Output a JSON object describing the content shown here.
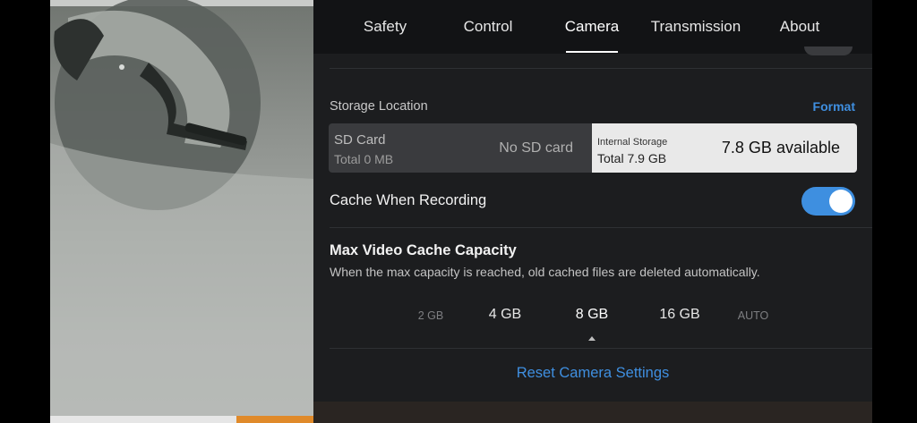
{
  "tabs": [
    {
      "label": "Safety"
    },
    {
      "label": "Control"
    },
    {
      "label": "Camera"
    },
    {
      "label": "Transmission"
    },
    {
      "label": "About"
    }
  ],
  "active_tab": "Camera",
  "storage": {
    "label": "Storage Location",
    "format_label": "Format",
    "sd": {
      "title": "SD Card",
      "total": "Total 0 MB",
      "status": "No SD card"
    },
    "internal": {
      "title": "Internal Storage",
      "total": "Total 7.9 GB",
      "status": "7.8 GB available"
    },
    "selected": "Internal Storage"
  },
  "cache_recording": {
    "label": "Cache When Recording",
    "enabled": true
  },
  "max_cache": {
    "title": "Max Video Cache Capacity",
    "description": "When the max capacity is reached, old cached files are deleted automatically.",
    "options": [
      "2 GB",
      "4 GB",
      "8 GB",
      "16 GB",
      "AUTO"
    ],
    "selected": "8 GB"
  },
  "reset_label": "Reset Camera Settings",
  "colors": {
    "accent": "#3f8fe0",
    "panel": "#1c1d1f"
  }
}
